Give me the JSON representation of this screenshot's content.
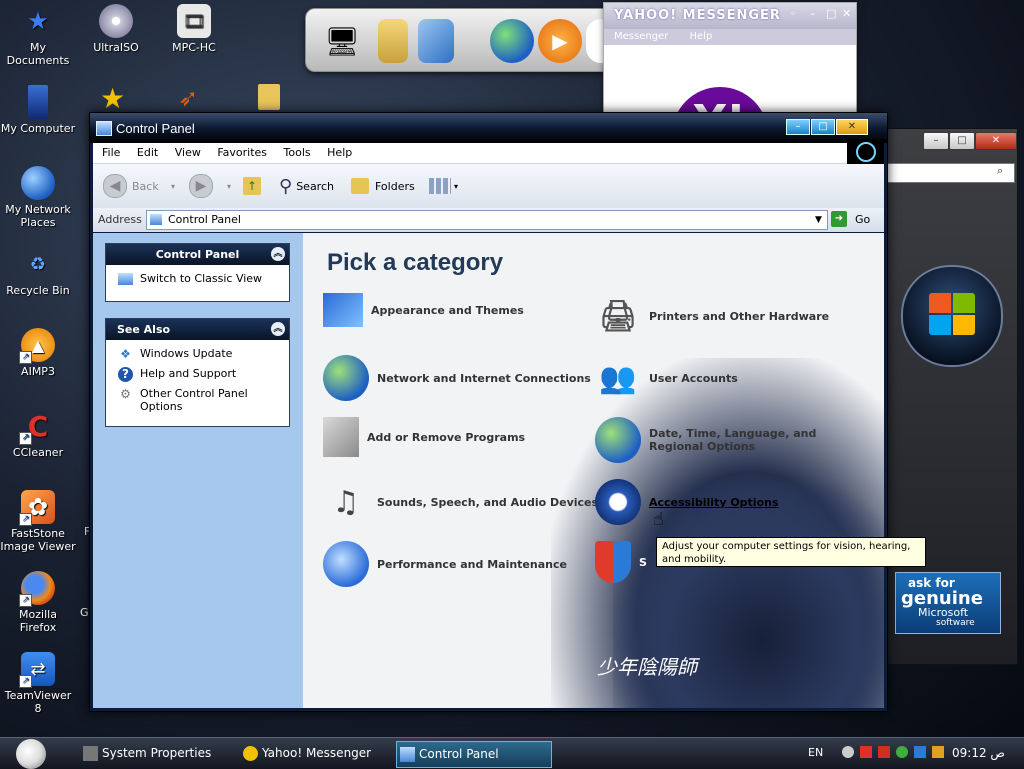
{
  "desktop": {
    "icons": [
      {
        "label": "My Documents",
        "icon": "star-icon"
      },
      {
        "label": "UltraISO",
        "icon": "disc-icon"
      },
      {
        "label": "MPC-HC",
        "icon": "film-icon"
      },
      {
        "label": "My Computer",
        "icon": "monitor-icon"
      },
      {
        "label": "My Network Places",
        "icon": "globe-icon"
      },
      {
        "label": "Recycle Bin",
        "icon": "recycle-bin-icon"
      },
      {
        "label": "AIMP3",
        "icon": "aimp-icon"
      },
      {
        "label": "CCleaner",
        "icon": "ccleaner-icon"
      },
      {
        "label": "FastStone Image Viewer",
        "icon": "faststone-icon"
      },
      {
        "label": "Mozilla Firefox",
        "icon": "firefox-icon"
      },
      {
        "label": "TeamViewer 8",
        "icon": "teamviewer-icon"
      }
    ],
    "partial_labels": [
      "F",
      "G"
    ]
  },
  "yahoo_window": {
    "title": "YAHOO! MESSENGER",
    "menu": [
      "Messenger",
      "Help"
    ],
    "logo": "Y!"
  },
  "control_panel": {
    "title": "Control Panel",
    "menu": [
      "File",
      "Edit",
      "View",
      "Favorites",
      "Tools",
      "Help"
    ],
    "toolbar": {
      "back": "Back",
      "search": "Search",
      "folders": "Folders"
    },
    "address": {
      "label": "Address",
      "value": "Control Panel",
      "go": "Go"
    },
    "left_pane": {
      "control_panel_box": {
        "title": "Control Panel",
        "items": [
          "Switch to Classic View"
        ]
      },
      "see_also_box": {
        "title": "See Also",
        "items": [
          "Windows Update",
          "Help and Support",
          "Other Control Panel Options"
        ]
      }
    },
    "heading": "Pick a category",
    "categories": [
      {
        "label": "Appearance and Themes",
        "icon": "appearance-icon"
      },
      {
        "label": "Printers and Other Hardware",
        "icon": "printer-icon"
      },
      {
        "label": "Network and Internet Connections",
        "icon": "network-icon"
      },
      {
        "label": "User Accounts",
        "icon": "users-icon"
      },
      {
        "label": "Add or Remove Programs",
        "icon": "programs-icon"
      },
      {
        "label": "Date, Time, Language, and Regional Options",
        "icon": "date-time-icon"
      },
      {
        "label": "Sounds, Speech, and Audio Devices",
        "icon": "sound-icon"
      },
      {
        "label": "Accessibility Options",
        "icon": "accessibility-icon"
      },
      {
        "label": "Performance and Maintenance",
        "icon": "performance-icon"
      },
      {
        "label": "S",
        "icon": "security-shield-icon"
      }
    ],
    "tooltip": "Adjust your computer settings for vision, hearing, and mobility.",
    "watermark": "少年陰陽師"
  },
  "genuine_badge": {
    "line1": "ask for",
    "line2": "genuine",
    "line3": "Microsoft",
    "line4": "software"
  },
  "taskbar": {
    "buttons": [
      "System Properties",
      "Yahoo! Messenger",
      "Control Panel"
    ],
    "language": "EN",
    "clock": "09:12 ص"
  }
}
